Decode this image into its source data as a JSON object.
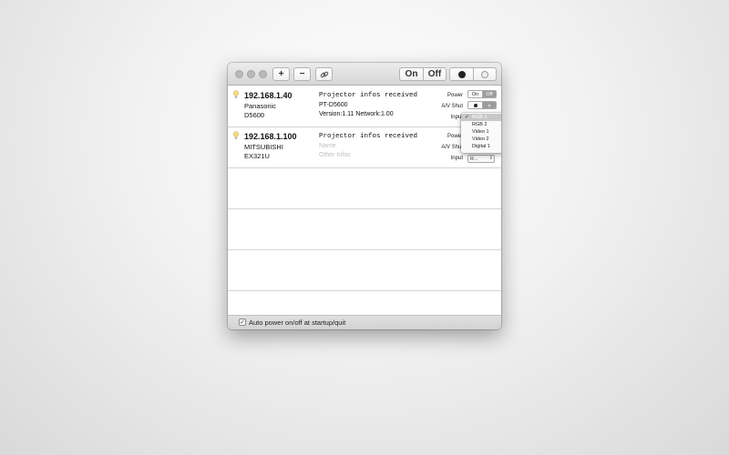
{
  "toolbar": {
    "add_label": "+",
    "remove_label": "−",
    "on_label": "On",
    "off_label": "Off"
  },
  "projectors": [
    {
      "ip": "192.168.1.40",
      "brand": "Panasonic",
      "model": "D5600",
      "status": "Projector infos received",
      "name": "PT-D5600",
      "other_info": "Version:1.11 Network:1.00",
      "power_label": "Power",
      "av_label": "A/V Shut",
      "input_label": "Input",
      "power_on": "On",
      "power_off": "Off"
    },
    {
      "ip": "192.168.1.100",
      "brand": "MITSUBISHI",
      "model": "EX321U",
      "status": "Projector infos received",
      "name_placeholder": "Name",
      "other_placeholder": "Other Infos",
      "power_label": "Power",
      "av_label": "A/V Shut",
      "input_label": "Input",
      "input_value": "R..."
    }
  ],
  "input_menu": {
    "options": [
      "RGB 1",
      "RGB 2",
      "Video 1",
      "Video 2",
      "Digital 1"
    ],
    "selected": "RGB 1"
  },
  "footer": {
    "auto_power_label": "Auto power on/off at startup/quit",
    "auto_power_checked": true
  },
  "colors": {
    "bulb": "#f2d98a",
    "selected_menu": "#c8c8c8"
  }
}
